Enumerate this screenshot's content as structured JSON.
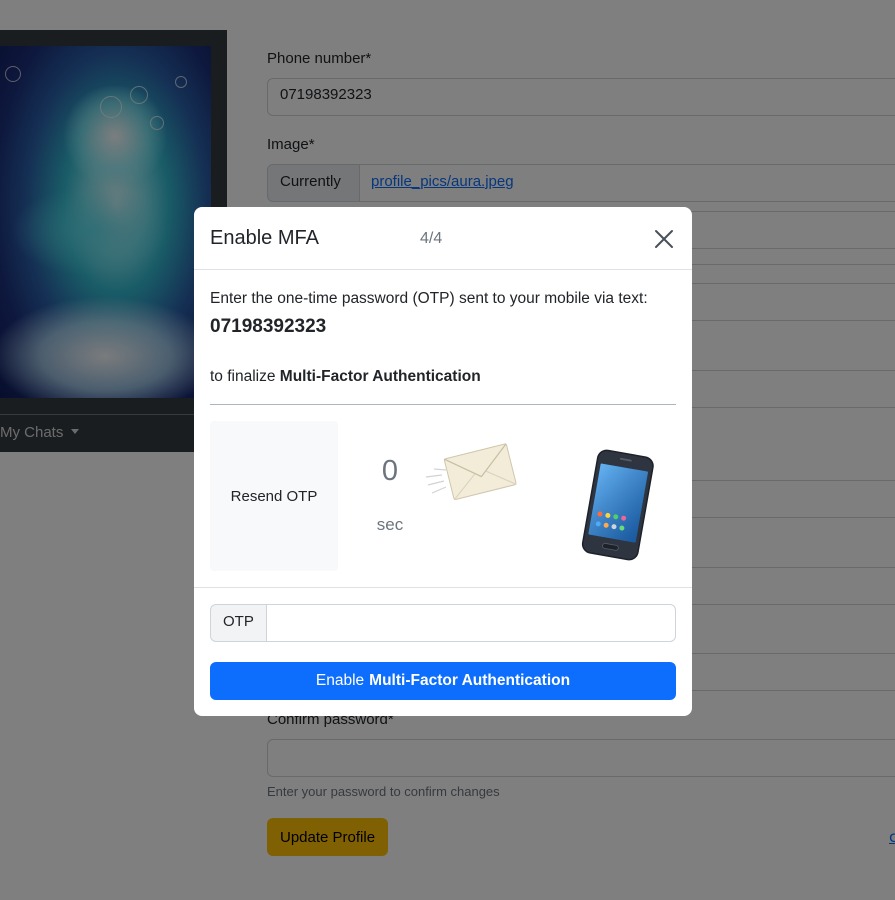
{
  "sidebar": {
    "chats_label": "My Chats"
  },
  "form": {
    "phone_label": "Phone number*",
    "phone_value": "07198392323",
    "image_label": "Image*",
    "currently_label": "Currently",
    "current_image_link": "profile_pics/aura.jpeg",
    "confirm_password_label": "Confirm password*",
    "confirm_password_value": "",
    "confirm_help": "Enter your password to confirm changes",
    "update_button": "Update Profile",
    "edge_link_text": "c"
  },
  "modal": {
    "title": "Enable MFA",
    "step": "4/4",
    "instruction": "Enter the one-time password (OTP) sent to your mobile via text:",
    "phone_number": "07198392323",
    "finalize_prefix": "to finalize",
    "finalize_bold": "Multi-Factor Authentication",
    "resend_button": "Resend OTP",
    "countdown_value": "0",
    "countdown_unit": "sec",
    "otp_label": "OTP",
    "otp_value": "",
    "enable_button_prefix": "Enable",
    "enable_button_bold": "Multi-Factor Authentication"
  },
  "colors": {
    "primary": "#0d6efd",
    "warning": "#ffc107",
    "dark_panel": "#343a40",
    "muted": "#6c757d"
  },
  "icons": {
    "close": "close-icon",
    "envelope": "envelope-icon",
    "phone": "mobile-phone-icon"
  }
}
